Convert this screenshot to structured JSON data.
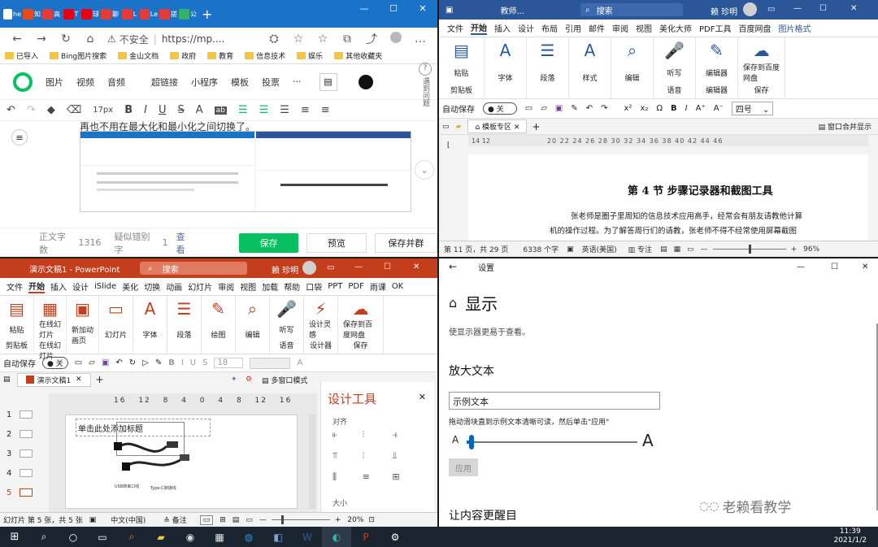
{
  "browser": {
    "tabs": [
      {
        "text": "he",
        "color": "#ffffff"
      },
      {
        "text": "知",
        "color": "#e84a1c"
      },
      {
        "text": "高",
        "color": "#e23b3b"
      },
      {
        "text": "T",
        "color": "#e60012"
      },
      {
        "text": "球",
        "color": "#e60012"
      },
      {
        "text": "聊",
        "color": "#e23b3b"
      },
      {
        "text": "L",
        "color": "#e23b3b"
      },
      {
        "text": "Le",
        "color": "#e23b3b"
      },
      {
        "text": "搓",
        "color": "#e23b3b"
      },
      {
        "text": "公",
        "color": "#33b06a"
      }
    ],
    "url_security": "不安全",
    "url": "https://mp....",
    "bookmarks": [
      "已导入",
      "Bing图片搜索",
      "金山文档",
      "政府",
      "教育",
      "信息技术",
      "娱乐",
      "其他收藏夹"
    ],
    "editor_menu": [
      "图片",
      "视频",
      "音频",
      "超链接",
      "小程序",
      "模板",
      "投票",
      "···"
    ],
    "side_help": "遇到问题",
    "font_size": "17px",
    "article_text": "再也不用在最大化和最小化之间切换了。",
    "word_count_label": "正文字数",
    "word_count": "1316",
    "typo_label": "疑似错别字",
    "typo_count": "1",
    "check_label": "查看",
    "save_label": "保存",
    "preview_label": "预览",
    "save_send_label": "保存并群"
  },
  "word": {
    "title": "教师...",
    "search_placeholder": "搜索",
    "user": "赖 珍明",
    "menu": [
      "文件",
      "开始",
      "插入",
      "设计",
      "布局",
      "引用",
      "邮件",
      "审阅",
      "视图",
      "美化大师",
      "PDF工具",
      "百度网盘",
      "图片格式"
    ],
    "ribbon_groups": [
      {
        "label": "粘贴",
        "group": "剪贴板"
      },
      {
        "label": "字体",
        "group": ""
      },
      {
        "label": "段落",
        "group": ""
      },
      {
        "label": "样式",
        "group": ""
      },
      {
        "label": "编辑",
        "group": ""
      },
      {
        "label": "听写",
        "group": "语音"
      },
      {
        "label": "编辑器",
        "group": "编辑器"
      },
      {
        "label": "保存到百度网盘",
        "group": "保存"
      }
    ],
    "autosave_label": "自动保存",
    "autosave_state": "关",
    "style_name": "四号",
    "tab_template": "模板专区",
    "window_merge": "窗口合并显示",
    "heading": "第 4 节  步骤记录器和截图工具",
    "body_line1": "张老师是圈子里周知的信息技术应用高手，经常会有朋友请教他计算",
    "body_line2": "机的操作过程。为了解答周行们的请教，张老师不得不经常使用屏幕截图",
    "status_page": "第 11 页，共 29 页",
    "status_words": "6338 个字",
    "status_lang": "英语(美国)",
    "status_focus": "专注",
    "zoom": "96%",
    "ruler_left": "14 12",
    "ruler_right": "20 22 24 26 28 30 32 34 36 38 40 42 44 46"
  },
  "ppt": {
    "title": "演示文稿1 - PowerPoint",
    "search_placeholder": "搜索",
    "user": "赖 珍明",
    "menu": [
      "文件",
      "开始",
      "插入",
      "设计",
      "iSlide",
      "美化",
      "切换",
      "动画",
      "幻灯片",
      "审阅",
      "视图",
      "加载",
      "帮助",
      "口袋",
      "PPT",
      "PDF",
      "雨课",
      "OK"
    ],
    "ribbon_groups": [
      {
        "label": "粘贴",
        "group": "剪贴板"
      },
      {
        "label": "在线幻灯片",
        "group": "在线幻灯片"
      },
      {
        "label": "新加动画页",
        "group": ""
      },
      {
        "label": "幻灯片",
        "group": ""
      },
      {
        "label": "字体",
        "group": ""
      },
      {
        "label": "段落",
        "group": ""
      },
      {
        "label": "绘图",
        "group": ""
      },
      {
        "label": "编辑",
        "group": ""
      },
      {
        "label": "听写",
        "group": "语音"
      },
      {
        "label": "设计灵感",
        "group": "设计器"
      },
      {
        "label": "保存到百度网盘",
        "group": "保存"
      }
    ],
    "autosave_label": "自动保存",
    "font_size": "18",
    "doc_tab": "演示文稿1",
    "multiwin": "多窗口模式",
    "slides": [
      "1",
      "2",
      "3",
      "4",
      "5"
    ],
    "ruler": "16 12 8 4 0 4 8 12 16",
    "placeholder_text": "单击此处添加标题",
    "caption1": "USB转串口线",
    "caption2": "Type-C转接线",
    "panel_title": "设计工具",
    "panel_align": "对齐",
    "panel_size": "大小",
    "status_slide": "幻灯片 第 5 张，共 5 张",
    "status_lang": "中文(中国)",
    "status_notes": "备注",
    "zoom": "20%"
  },
  "settings": {
    "title": "设置",
    "heading": "显示",
    "description": "使显示器更易于查看。",
    "section_enlarge": "放大文本",
    "sample_text": "示例文本",
    "slider_hint": "拖动滑块直到示例文本清晰可读，然后单击\"应用\"",
    "slider_min_label": "A",
    "slider_max_label": "A",
    "slider_value": 0.02,
    "apply_label": "应用",
    "section_next": "让内容更醒目",
    "watermark": "老赖看教学"
  },
  "taskbar": {
    "apps": [
      {
        "name": "search-icon",
        "color": "#ffffff"
      },
      {
        "name": "cortana-icon",
        "color": "#ffffff"
      },
      {
        "name": "taskview-icon",
        "color": "#ffffff"
      },
      {
        "name": "search-app-icon",
        "color": "#ff7a00"
      },
      {
        "name": "folder-icon",
        "color": "#f4c542"
      },
      {
        "name": "network-icon",
        "color": "#d9d9d9"
      },
      {
        "name": "calculator-icon",
        "color": "#e6e6e6"
      },
      {
        "name": "globe-icon",
        "color": "#2f8fd8"
      },
      {
        "name": "steps-recorder-icon",
        "color": "#7aa5d8"
      },
      {
        "name": "word-icon",
        "color": "#2b579a"
      },
      {
        "name": "edge-icon",
        "color": "#2fb7a6"
      },
      {
        "name": "powerpoint-icon",
        "color": "#c43e1c"
      },
      {
        "name": "settings-icon",
        "color": "#ffffff"
      }
    ],
    "time": "11:39",
    "date": "2021/1/2"
  }
}
